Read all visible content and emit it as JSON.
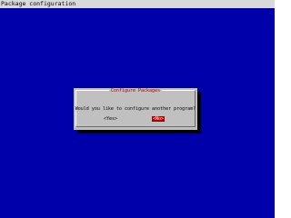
{
  "window": {
    "title": "Package configuration"
  },
  "dialog": {
    "title": "Configure Packages",
    "question": "Would you like to configure another program?",
    "buttons": {
      "yes": "<Yes>",
      "no": "<No>"
    },
    "focused_button": "no"
  },
  "colors": {
    "background": "#0000aa",
    "dialog": "#c0c0c0",
    "title_text": "#aa0000",
    "focus_button_bg": "#aa0000",
    "focus_button_text": "#ffffff"
  }
}
